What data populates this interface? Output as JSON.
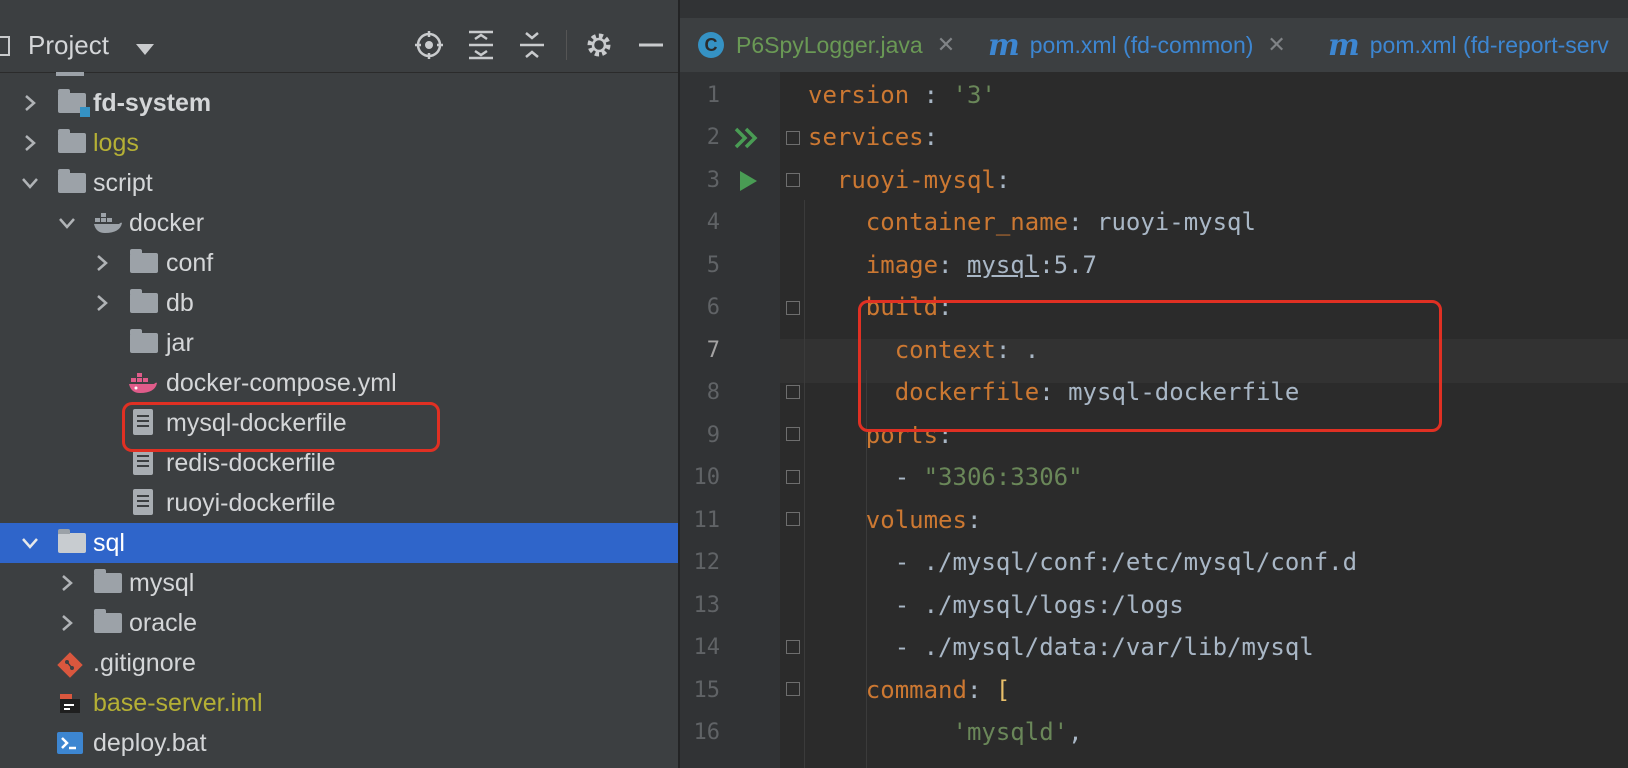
{
  "project_panel": {
    "title": "Project",
    "toolbar_icons": [
      "locate-icon",
      "expand-all-icon",
      "collapse-all-icon",
      "gear-icon",
      "minimize-icon"
    ],
    "tree": [
      {
        "label": "fd-system",
        "icon": "module-folder-icon",
        "arrow": "collapsed",
        "style": "bold"
      },
      {
        "label": "logs",
        "icon": "folder-icon",
        "arrow": "collapsed",
        "style": "yellow"
      },
      {
        "label": "script",
        "icon": "folder-icon",
        "arrow": "expanded",
        "style": "normal"
      },
      {
        "label": "docker",
        "icon": "docker-icon",
        "arrow": "expanded",
        "style": "normal"
      },
      {
        "label": "conf",
        "icon": "folder-icon",
        "arrow": "collapsed",
        "style": "normal"
      },
      {
        "label": "db",
        "icon": "folder-icon",
        "arrow": "collapsed",
        "style": "normal"
      },
      {
        "label": "jar",
        "icon": "folder-icon",
        "arrow": "none",
        "style": "normal"
      },
      {
        "label": "docker-compose.yml",
        "icon": "docker-compose-icon",
        "arrow": "none",
        "style": "normal"
      },
      {
        "label": "mysql-dockerfile",
        "icon": "file-icon",
        "arrow": "none",
        "style": "normal"
      },
      {
        "label": "redis-dockerfile",
        "icon": "file-icon",
        "arrow": "none",
        "style": "normal"
      },
      {
        "label": "ruoyi-dockerfile",
        "icon": "file-icon",
        "arrow": "none",
        "style": "normal"
      },
      {
        "label": "sql",
        "icon": "folder-icon",
        "arrow": "expanded",
        "style": "selected"
      },
      {
        "label": "mysql",
        "icon": "folder-icon",
        "arrow": "collapsed",
        "style": "normal"
      },
      {
        "label": "oracle",
        "icon": "folder-icon",
        "arrow": "collapsed",
        "style": "normal"
      },
      {
        "label": ".gitignore",
        "icon": "git-icon",
        "arrow": "none",
        "style": "normal"
      },
      {
        "label": "base-server.iml",
        "icon": "iml-icon",
        "arrow": "none",
        "style": "yellow"
      },
      {
        "label": "deploy.bat",
        "icon": "terminal-icon",
        "arrow": "none",
        "style": "normal"
      }
    ]
  },
  "editor": {
    "tabs": [
      {
        "icon": "C",
        "label": "P6SpyLogger.java",
        "color": "#6a9955"
      },
      {
        "icon": "m",
        "label": "pom.xml (fd-common)",
        "color": "#3d86d1"
      },
      {
        "icon": "m",
        "label": "pom.xml (fd-report-serv",
        "color": "#3d86d1"
      }
    ],
    "lines": [
      {
        "num": "1",
        "text": "version : '3'"
      },
      {
        "num": "2",
        "text": "services:"
      },
      {
        "num": "3",
        "text": "  ruoyi-mysql:"
      },
      {
        "num": "4",
        "text": "    container_name: ruoyi-mysql"
      },
      {
        "num": "5",
        "text": "    image: mysql:5.7"
      },
      {
        "num": "6",
        "text": "    build:"
      },
      {
        "num": "7",
        "text": "      context: ."
      },
      {
        "num": "8",
        "text": "      dockerfile: mysql-dockerfile"
      },
      {
        "num": "9",
        "text": "    ports:"
      },
      {
        "num": "10",
        "text": "      - \"3306:3306\""
      },
      {
        "num": "11",
        "text": "    volumes:"
      },
      {
        "num": "12",
        "text": "      - ./mysql/conf:/etc/mysql/conf.d"
      },
      {
        "num": "13",
        "text": "      - ./mysql/logs:/logs"
      },
      {
        "num": "14",
        "text": "      - ./mysql/data:/var/lib/mysql"
      },
      {
        "num": "15",
        "text": "    command: ["
      },
      {
        "num": "16",
        "text": "          'mysqld',"
      }
    ],
    "current_line": "7",
    "run_markers": [
      "run-all-icon",
      "run-icon"
    ]
  },
  "colors": {
    "panel_bg": "#3c3f41",
    "editor_bg": "#2b2b2b",
    "selection": "#2f65ca",
    "highlight_box": "#e03023",
    "keyword": "#cc7832",
    "string": "#6a8759"
  }
}
